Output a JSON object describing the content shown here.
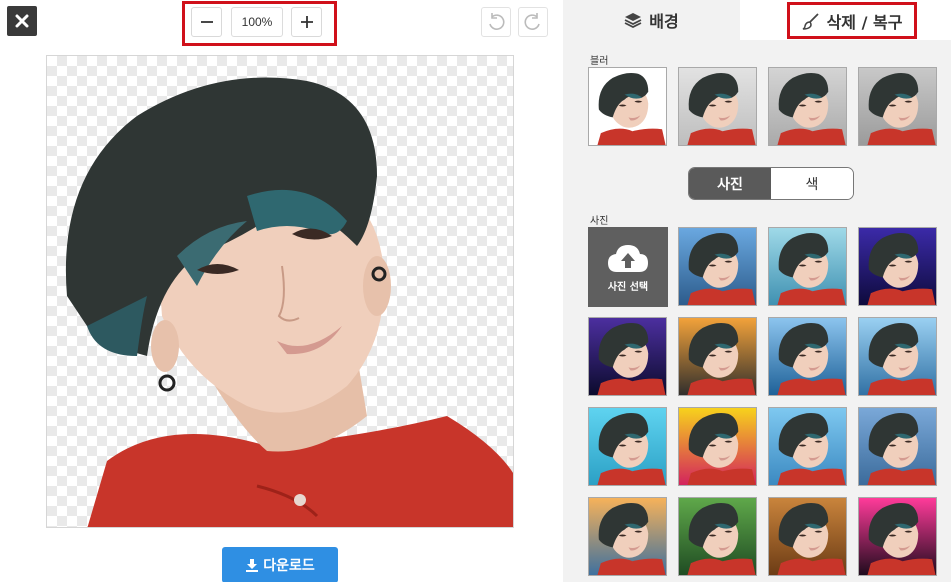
{
  "toolbar": {
    "close_icon": "close-icon",
    "zoom_out_icon": "minus-icon",
    "zoom_in_icon": "plus-icon",
    "zoom_level": "100%",
    "undo_icon": "undo-icon",
    "redo_icon": "redo-icon"
  },
  "download": {
    "label": "다운로드",
    "icon": "download-icon",
    "color": "#2f8fe3"
  },
  "tabs": [
    {
      "label": "배경",
      "icon": "layers-icon",
      "active": false
    },
    {
      "label": "삭제 / 복구",
      "icon": "brush-icon",
      "active": true
    }
  ],
  "blur": {
    "label": "블러",
    "thumbnails": [
      "blur-0",
      "blur-1",
      "blur-2",
      "blur-3"
    ]
  },
  "mode_toggle": {
    "options": [
      "사진",
      "색"
    ],
    "selected": "사진"
  },
  "photos": {
    "label": "사진",
    "upload_label": "사진 선택",
    "upload_icon": "cloud-upload-icon",
    "backgrounds": [
      "mountain-lake",
      "bokeh-teal",
      "stage-lights",
      "galaxy",
      "autumn-leaves",
      "city-harbor",
      "golden-gate",
      "beach-pier",
      "colorful-stripes",
      "beach-sky",
      "coastal-road",
      "city-sunset",
      "jungle-leaves",
      "wooden-frame",
      "neon-dots"
    ]
  },
  "colors": {
    "highlight": "#d0101a",
    "panel_bg": "#f2f2f2",
    "toggle_active": "#5a5a5a"
  }
}
